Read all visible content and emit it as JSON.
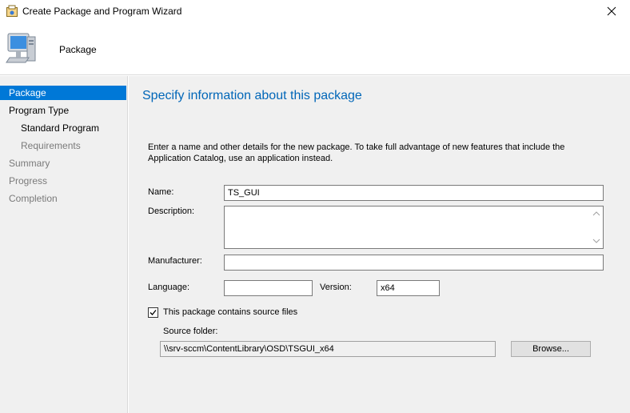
{
  "window": {
    "title": "Create Package and Program Wizard",
    "icons": {
      "title": "wizard-icon",
      "close": "close-icon"
    }
  },
  "header": {
    "title": "Package",
    "icon": "computer-icon"
  },
  "sidebar": {
    "items": [
      {
        "label": "Package",
        "state": "active"
      },
      {
        "label": "Program Type",
        "state": "normal"
      },
      {
        "label": "Standard Program",
        "state": "normal"
      },
      {
        "label": "Requirements",
        "state": "dim"
      },
      {
        "label": "Summary",
        "state": "dim"
      },
      {
        "label": "Progress",
        "state": "dim"
      },
      {
        "label": "Completion",
        "state": "dim"
      }
    ]
  },
  "main": {
    "heading": "Specify information about this package",
    "intro": "Enter a name and other details for the new package. To take full advantage of new features that include the Application Catalog, use an application instead.",
    "form": {
      "name_label": "Name:",
      "name_value": "TS_GUI",
      "description_label": "Description:",
      "description_value": "",
      "manufacturer_label": "Manufacturer:",
      "manufacturer_value": "",
      "language_label": "Language:",
      "language_value": "",
      "version_label": "Version:",
      "version_value": "x64",
      "source_checkbox_label": "This package contains source files",
      "source_checkbox_checked": true,
      "source_folder_label": "Source folder:",
      "source_folder_value": "\\\\srv-sccm\\ContentLibrary\\OSD\\TSGUI_x64",
      "browse_label": "Browse..."
    }
  },
  "colors": {
    "accent": "#0078d7",
    "heading": "#0066b8",
    "panel": "#f0f0f0"
  }
}
